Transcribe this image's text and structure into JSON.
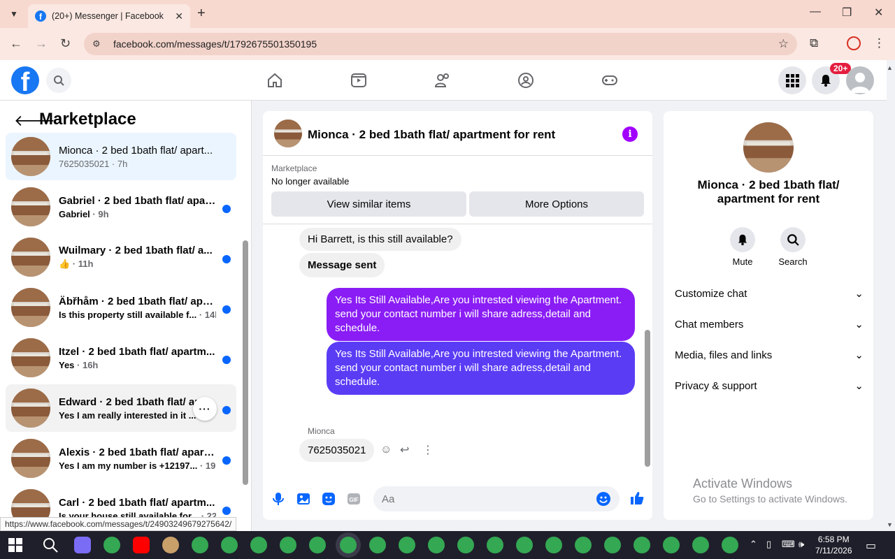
{
  "browser": {
    "tab_title": "(20+) Messenger | Facebook",
    "url": "facebook.com/messages/t/1792675501350195",
    "status_url": "https://www.facebook.com/messages/t/24903249679275642/"
  },
  "header": {
    "notification_badge": "20+"
  },
  "left_panel": {
    "title": "Marketplace",
    "conversations": [
      {
        "name": "Mionca · 2 bed 1bath flat/ apart...",
        "preview": "7625035021",
        "time": " · 7h",
        "unread": false
      },
      {
        "name": "Gabriel · 2 bed 1bath flat/ apar...",
        "preview": "Gabriel",
        "time": " · 9h",
        "unread": true
      },
      {
        "name": "Wuilmary · 2 bed 1bath flat/ a...",
        "preview": "👍",
        "time": " · 11h",
        "unread": true
      },
      {
        "name": "Äbřhåm · 2 bed 1bath flat/ apa...",
        "preview": "Is this property still available f...",
        "time": " · 14h",
        "unread": true
      },
      {
        "name": "Itzel · 2 bed 1bath flat/ apartm...",
        "preview": "Yes",
        "time": " · 16h",
        "unread": true
      },
      {
        "name": "Edward · 2 bed 1bath flat/ ap...",
        "preview": "Yes I am really interested in it ...",
        "time": "",
        "unread": true
      },
      {
        "name": "Alexis · 2 bed 1bath flat/ apart...",
        "preview": "Yes I am my number is +12197...",
        "time": " · 19h",
        "unread": true
      },
      {
        "name": "Carl · 2 bed 1bath flat/ apartm...",
        "preview": "Is your house still available for...",
        "time": " · 22h",
        "unread": true
      }
    ]
  },
  "chat": {
    "title": "Mionca · 2 bed 1bath flat/ apartment for rent",
    "marketplace_label": "Marketplace",
    "listing_status": "No longer available",
    "btn_similar": "View similar items",
    "btn_more": "More Options",
    "messages": {
      "m1": "Hi Barrett, is this still available?",
      "m2": "Message sent",
      "m3": "Yes Its Still Available,Are you intrested viewing the Apartment. send your contact number i will share adress,detail and schedule.",
      "m4": "Yes Its Still Available,Are you intrested viewing the Apartment. send your contact number i will share adress,detail and schedule.",
      "sender": "Mionca",
      "m5": "7625035021"
    },
    "input_placeholder": "Aa",
    "colors": {
      "bubble_out_top": "#8a1df5",
      "bubble_out_bottom": "#5b3cf5",
      "accent": "#0866ff"
    }
  },
  "right_panel": {
    "name": "Mionca · 2 bed 1bath flat/ apartment for rent",
    "mute": "Mute",
    "search": "Search",
    "rows": [
      "Customize chat",
      "Chat members",
      "Media, files and links",
      "Privacy & support"
    ]
  },
  "watermark": {
    "line1": "Activate Windows",
    "line2": "Go to Settings to activate Windows."
  },
  "taskbar": {
    "time": "6:58 PM",
    "date": "7/11/2026"
  }
}
